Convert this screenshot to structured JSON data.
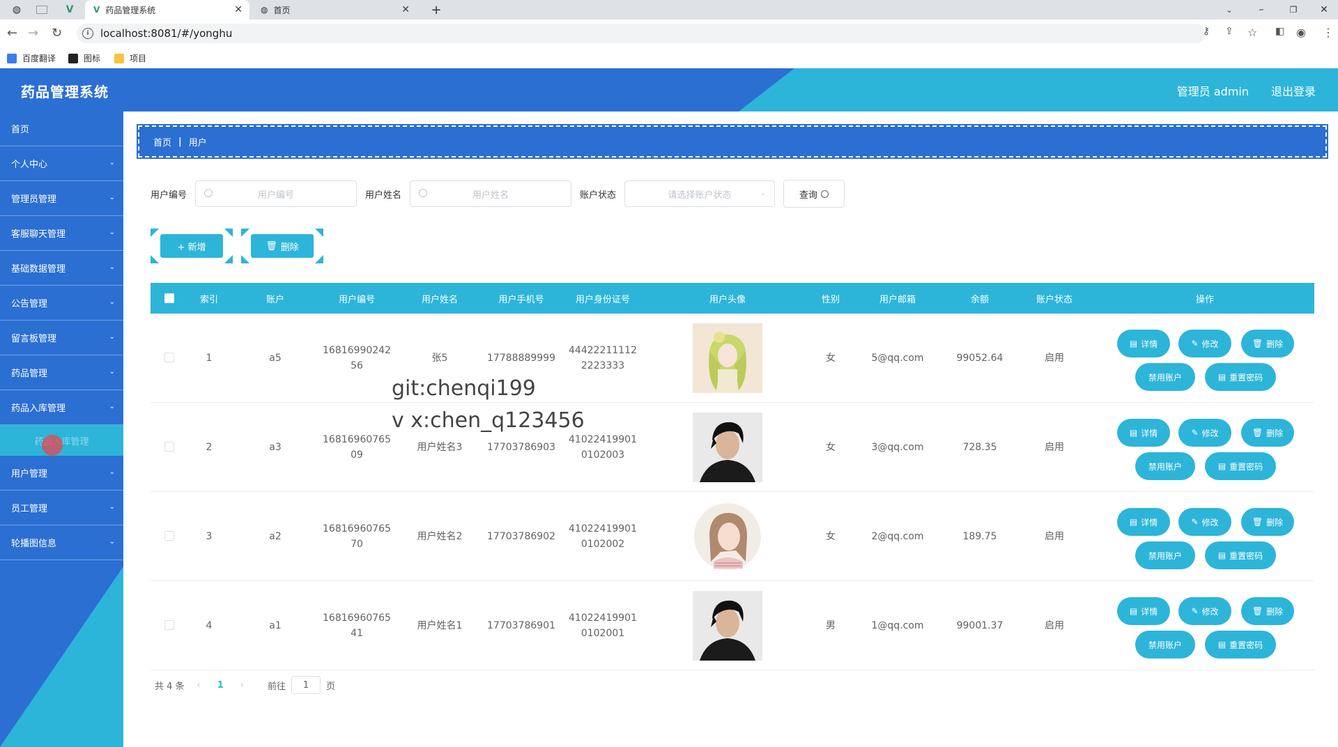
{
  "browser": {
    "tabs": [
      {
        "title": "药品管理系统",
        "active": true
      },
      {
        "title": "首页",
        "active": false
      }
    ],
    "url": "localhost:8081/#/yonghu",
    "bookmarks": [
      "百度翻译",
      "图标",
      "项目"
    ]
  },
  "header": {
    "title": "药品管理系统",
    "user": "管理员 admin",
    "logout": "退出登录"
  },
  "sidebar": {
    "items": [
      {
        "label": "首页",
        "has_children": false
      },
      {
        "label": "个人中心",
        "has_children": true
      },
      {
        "label": "管理员管理",
        "has_children": true
      },
      {
        "label": "客服聊天管理",
        "has_children": true
      },
      {
        "label": "基础数据管理",
        "has_children": true
      },
      {
        "label": "公告管理",
        "has_children": true
      },
      {
        "label": "留言板管理",
        "has_children": true
      },
      {
        "label": "药品管理",
        "has_children": true
      },
      {
        "label": "药品入库管理",
        "has_children": true
      }
    ],
    "submenu_label": "药品入库管理",
    "items_after": [
      {
        "label": "用户管理"
      },
      {
        "label": "员工管理"
      },
      {
        "label": "轮播图信息"
      }
    ]
  },
  "breadcrumb": {
    "home": "首页",
    "current": "用户"
  },
  "search": {
    "label_code": "用户编号",
    "ph_code": "用户编号",
    "label_name": "用户姓名",
    "ph_name": "用户姓名",
    "label_status": "账户状态",
    "ph_status": "请选择账户状态",
    "query": "查询"
  },
  "actions": {
    "add": "+ 新增",
    "delete": "删除"
  },
  "table": {
    "columns": [
      "索引",
      "账户",
      "用户编号",
      "用户姓名",
      "用户手机号",
      "用户身份证号",
      "用户头像",
      "性别",
      "用户邮箱",
      "余额",
      "账户状态",
      "操作"
    ],
    "op_labels": {
      "detail": "详情",
      "edit": "修改",
      "delete": "删除",
      "disable": "禁用账户",
      "reset": "重置密码"
    },
    "rows": [
      {
        "index": "1",
        "account": "a5",
        "code_1": "16816990242",
        "code_2": "56",
        "name": "张5",
        "phone": "17788889999",
        "id_1": "44422211112",
        "id_2": "2223333",
        "avatar": "anime-girl",
        "gender": "女",
        "email": "5@qq.com",
        "balance": "99052.64",
        "status": "启用"
      },
      {
        "index": "2",
        "account": "a3",
        "code_1": "16816960765",
        "code_2": "09",
        "name": "用户姓名3",
        "phone": "17703786903",
        "id_1": "41022419901",
        "id_2": "0102003",
        "avatar": "young-man",
        "gender": "女",
        "email": "3@qq.com",
        "balance": "728.35",
        "status": "启用"
      },
      {
        "index": "3",
        "account": "a2",
        "code_1": "16816960765",
        "code_2": "70",
        "name": "用户姓名2",
        "phone": "17703786902",
        "id_1": "41022419901",
        "id_2": "0102002",
        "avatar": "girl-sketch",
        "gender": "女",
        "email": "2@qq.com",
        "balance": "189.75",
        "status": "启用"
      },
      {
        "index": "4",
        "account": "a1",
        "code_1": "16816960765",
        "code_2": "41",
        "name": "用户姓名1",
        "phone": "17703786901",
        "id_1": "41022419901",
        "id_2": "0102001",
        "avatar": "young-man",
        "gender": "男",
        "email": "1@qq.com",
        "balance": "99001.37",
        "status": "启用"
      }
    ]
  },
  "pagination": {
    "total": "共 4 条",
    "current": "1",
    "goto": "前往",
    "goto_value": "1",
    "page_unit": "页"
  },
  "overlay": {
    "line1": "git:chenqi199",
    "line2": "v x:chen_q123456"
  },
  "colors": {
    "primary_blue": "#2b6fd3",
    "accent_cyan": "#2db5d9"
  }
}
